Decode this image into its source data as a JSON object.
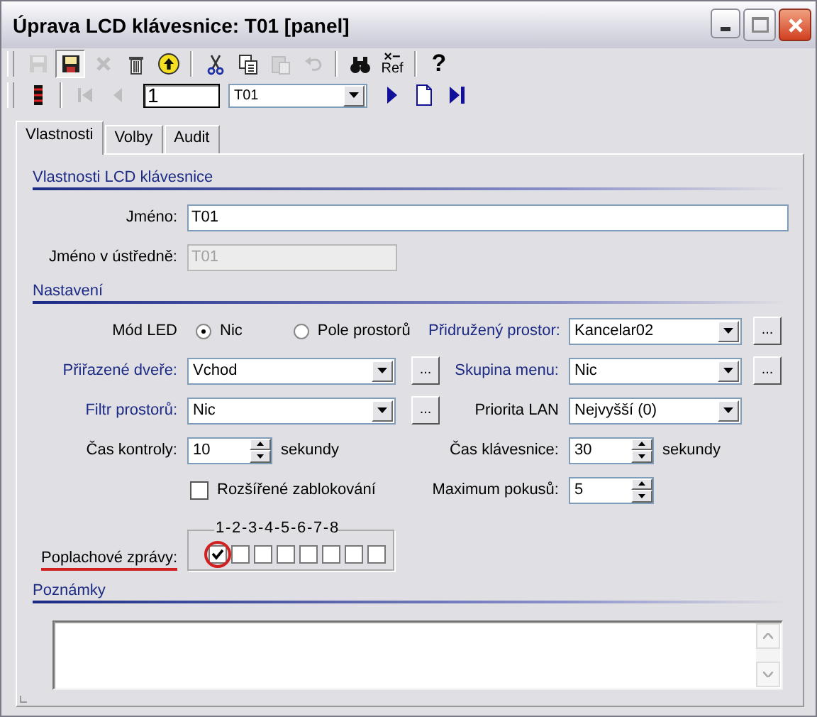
{
  "window": {
    "title": "Úprava LCD klávesnice: T01 [panel]",
    "controls": [
      {
        "kind": "minimize"
      },
      {
        "kind": "maximize"
      },
      {
        "kind": "close"
      }
    ]
  },
  "toolbar": [
    {
      "kind": "save",
      "disabled": true
    },
    {
      "kind": "save-as",
      "disabled": false
    },
    {
      "kind": "delete",
      "disabled": true
    },
    {
      "kind": "trash",
      "disabled": false
    },
    {
      "kind": "up",
      "disabled": false
    },
    {
      "kind": "sep"
    },
    {
      "kind": "cut",
      "disabled": false
    },
    {
      "kind": "copy",
      "disabled": false
    },
    {
      "kind": "paste",
      "disabled": true
    },
    {
      "kind": "undo",
      "disabled": true
    },
    {
      "kind": "sep"
    },
    {
      "kind": "find",
      "disabled": false
    },
    {
      "kind": "xref",
      "top": "×−",
      "label": "Ref",
      "disabled": false
    },
    {
      "kind": "sep"
    },
    {
      "kind": "help",
      "label": "?",
      "disabled": false
    }
  ],
  "navigator": [
    {
      "kind": "list",
      "disabled": false
    },
    {
      "kind": "sep"
    },
    {
      "kind": "first",
      "disabled": true
    },
    {
      "kind": "prev",
      "disabled": true
    },
    {
      "kind": "record",
      "value": "1"
    },
    {
      "kind": "combo",
      "value": "T01"
    },
    {
      "kind": "next",
      "disabled": false
    },
    {
      "kind": "new",
      "disabled": false
    },
    {
      "kind": "last",
      "disabled": false
    }
  ],
  "tabs": [
    {
      "label": "Vlastnosti",
      "selected": true
    },
    {
      "label": "Volby",
      "selected": false
    },
    {
      "label": "Audit",
      "selected": false
    }
  ],
  "sections": [
    {
      "title": "Vlastnosti LCD klávesnice",
      "rows": [
        {
          "full": {
            "label": "Jméno:",
            "link": false,
            "kind": "text",
            "value": "T01",
            "disabled": false
          }
        },
        {
          "left": {
            "label": "Jméno v ústředně:",
            "link": false,
            "kind": "text",
            "value": "T01",
            "disabled": true
          }
        }
      ]
    },
    {
      "title": "Nastavení",
      "rows": [
        {
          "left": {
            "label": "Mód LED",
            "link": false,
            "kind": "radio",
            "options": [
              {
                "label": "Nic",
                "selected": true
              },
              {
                "label": "Pole prostorů",
                "selected": false
              }
            ]
          },
          "right": {
            "label": "Přidružený prostor:",
            "link": true,
            "kind": "select",
            "value": "Kancelar02",
            "button": "..."
          }
        },
        {
          "left": {
            "label": "Přiřazené dveře:",
            "link": true,
            "kind": "select",
            "value": "Vchod",
            "button": "..."
          },
          "right": {
            "label": "Skupina menu:",
            "link": true,
            "kind": "select",
            "value": "Nic",
            "button": "..."
          }
        },
        {
          "left": {
            "label": "Filtr prostorů:",
            "link": true,
            "kind": "select",
            "value": "Nic",
            "button": "..."
          },
          "right": {
            "label": "Priorita LAN",
            "link": false,
            "kind": "select",
            "value": "Nejvyšší (0)"
          }
        },
        {
          "left": {
            "label": "Čas kontroly:",
            "link": false,
            "kind": "spinner",
            "value": "10",
            "unit": "sekundy"
          },
          "right": {
            "label": "Čas klávesnice:",
            "link": false,
            "kind": "spinner",
            "value": "30",
            "unit": "sekundy"
          }
        },
        {
          "left": {
            "kind": "checkbox",
            "text": "Rozšířené zablokování",
            "checked": false
          },
          "right": {
            "label": "Maximum pokusů:",
            "link": false,
            "kind": "spinner",
            "value": "5"
          }
        },
        {
          "left": {
            "label": "Poplachové zprávy:",
            "link": false,
            "underlined": true,
            "kind": "checkgroup",
            "legend": "1 - 2 - 3 - 4 - 5 - 6 - 7 - 8",
            "items": [
              {
                "checked": true,
                "circled": true
              },
              {
                "checked": false,
                "circled": false
              },
              {
                "checked": false,
                "circled": false
              },
              {
                "checked": false,
                "circled": false
              },
              {
                "checked": false,
                "circled": false
              },
              {
                "checked": false,
                "circled": false
              },
              {
                "checked": false,
                "circled": false
              },
              {
                "checked": false,
                "circled": false
              }
            ]
          }
        }
      ]
    },
    {
      "title": "Poznámky",
      "rows": [
        {
          "notes": {
            "kind": "textarea"
          }
        }
      ]
    }
  ]
}
